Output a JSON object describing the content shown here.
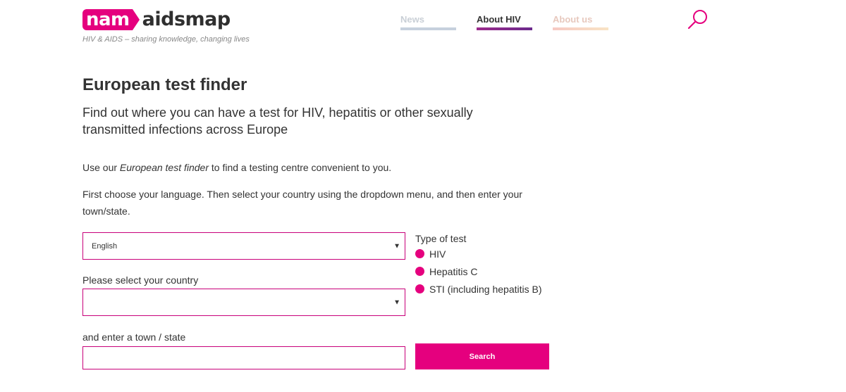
{
  "header": {
    "logo_nam": "nam",
    "logo_aidsmap": "aidsmap",
    "tagline": "HIV & AIDS – sharing knowledge, changing lives",
    "nav": [
      {
        "label": "News"
      },
      {
        "label": "About HIV"
      },
      {
        "label": "About us"
      }
    ],
    "search_icon": "search-icon"
  },
  "main": {
    "title": "European test finder",
    "subtitle": "Find out where you can have a test for HIV, hepatitis or other sexually transmitted infections across Europe",
    "intro_before": "Use our ",
    "intro_em": "European test finder",
    "intro_after": " to find a testing centre convenient to you.",
    "instructions": "First choose your language. Then select your country using the dropdown menu, and then enter your town/state."
  },
  "form": {
    "language_value": "English",
    "country_label": "Please select your country",
    "country_value": "",
    "town_label": "and enter a town / state",
    "town_value": "",
    "test_type_label": "Type of test",
    "test_options": [
      {
        "label": "HIV"
      },
      {
        "label": "Hepatitis C"
      },
      {
        "label": "STI (including hepatitis B)"
      }
    ],
    "search_button": "Search",
    "caret": "▼"
  },
  "colors": {
    "accent": "#e5007e",
    "border": "#c8007a",
    "text": "#333333"
  }
}
